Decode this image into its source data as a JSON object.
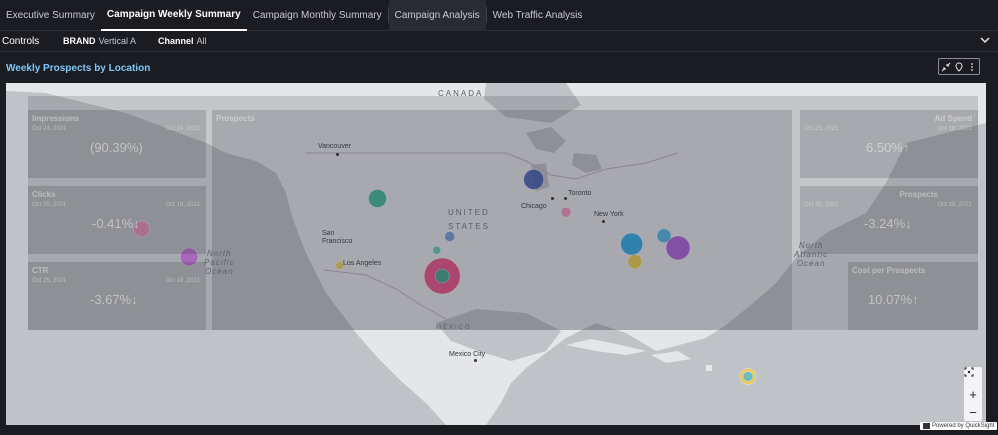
{
  "tabs": [
    {
      "label": "Executive Summary",
      "active": false
    },
    {
      "label": "Campaign Weekly Summary",
      "active": true
    },
    {
      "label": "Campaign Monthly Summary",
      "active": false
    },
    {
      "label": "Campaign Analysis",
      "active": false
    },
    {
      "label": "Web Traffic Analysis",
      "active": false
    }
  ],
  "controls": {
    "label": "Controls",
    "brand_key": "BRAND",
    "brand_value": "Vertical A",
    "channel_key": "Channel",
    "channel_value": "All"
  },
  "visual": {
    "title": "Weekly Prospects by Location"
  },
  "map": {
    "countries": {
      "canada": "CANADA",
      "us_line1": "UNITED",
      "us_line2": "STATES",
      "mexico": "MÉXICO"
    },
    "oceans": {
      "north_pacific": "North\nPacific\nOcean",
      "north_atlantic": "North\nAtlantic\nOcean"
    },
    "cities": {
      "vancouver": "Vancouver",
      "san_francisco": "San\nFrancisco",
      "los_angeles": "Los Angeles",
      "chicago": "Chicago",
      "toronto": "Toronto",
      "new_york": "New York",
      "mexico_city": "Mexico City"
    },
    "zoom_in": "+",
    "zoom_out": "−"
  },
  "bubbles": [
    {
      "lon": -86.0,
      "lat": 44.3,
      "size": 10,
      "color": "#3a56b0"
    },
    {
      "lon": -100.5,
      "lat": 41.8,
      "size": 9,
      "color": "#2ab58f"
    },
    {
      "lon": -93.8,
      "lat": 36.8,
      "size": 5,
      "color": "#6c8fd6"
    },
    {
      "lon": -83.0,
      "lat": 40.0,
      "size": 5,
      "color": "#f08bb5"
    },
    {
      "lon": -76.9,
      "lat": 35.8,
      "size": 11,
      "color": "#1aa1e6"
    },
    {
      "lon": -73.9,
      "lat": 36.9,
      "size": 7,
      "color": "#42aee6"
    },
    {
      "lon": -72.6,
      "lat": 35.3,
      "size": 12,
      "color": "#a44fd8"
    },
    {
      "lon": -76.6,
      "lat": 33.5,
      "size": 7,
      "color": "#f0c83c"
    },
    {
      "lon": -122.4,
      "lat": 37.8,
      "size": 8,
      "color": "#f08bb5"
    },
    {
      "lon": -118.0,
      "lat": 34.1,
      "size": 9,
      "color": "#c16ad8"
    },
    {
      "lon": -94.5,
      "lat": 31.6,
      "size": 18,
      "color": "#e8407c"
    },
    {
      "lon": -94.5,
      "lat": 31.6,
      "size": 7,
      "color": "#2ab58f"
    },
    {
      "lon": -95.0,
      "lat": 35.0,
      "size": 4,
      "color": "#52c8a8"
    },
    {
      "lon": -104.0,
      "lat": 33.0,
      "size": 4,
      "color": "#f0d04a"
    },
    {
      "lon": -66.1,
      "lat": 18.4,
      "size": 8,
      "color": "#f0c83c"
    },
    {
      "lon": -66.1,
      "lat": 18.4,
      "size": 5,
      "color": "#56b8d8"
    }
  ],
  "overlay": {
    "left_tiles": [
      {
        "title": "Impressions",
        "big": "(90.39%)",
        "left_date": "Oct 24, 2021",
        "right_date": "Oct 24, 2021"
      },
      {
        "title": "Clicks",
        "big": "-0.41%↓",
        "left_date": "Oct 25, 2021",
        "right_date": "Oct 18, 2021"
      },
      {
        "title": "CTR",
        "big": "-3.67%↓",
        "left_date": "Oct 25, 2021",
        "right_date": "Oct 18, 2021"
      }
    ],
    "right_tiles": [
      {
        "title": "Ad Spend",
        "big": "6.50%↑",
        "left_date": "Oct 25, 2021",
        "right_date": "Oct 18, 2021"
      },
      {
        "title": "Prospects",
        "big": "-3.24%↓",
        "left_date": "Oct 25, 2021",
        "right_date": "Oct 18, 2021"
      },
      {
        "title": "Cost per Prospects",
        "big": "10.07%↑",
        "left_date": "",
        "right_date": ""
      }
    ],
    "center_title": "Prospects"
  },
  "powered": "Powered by QuickSight",
  "colors": {
    "accent": "#7fc8f8",
    "background": "#1b1b22",
    "land": "#e4e6ea",
    "water": "#bfc3c8"
  }
}
